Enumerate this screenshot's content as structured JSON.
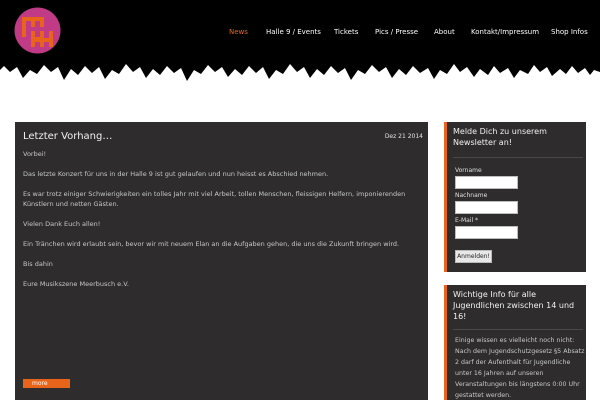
{
  "header": {
    "logo_icon": "mh-logo-icon",
    "nav": [
      {
        "label": "News",
        "active": true
      },
      {
        "label": "Halle 9 / Events",
        "active": false
      },
      {
        "label": "Tickets",
        "active": false
      },
      {
        "label": "Pics / Presse",
        "active": false
      },
      {
        "label": "About",
        "active": false
      },
      {
        "label": "Kontakt/Impressum",
        "active": false
      },
      {
        "label": "Shop Infos",
        "active": false
      }
    ]
  },
  "post": {
    "title": "Letzter Vorhang…",
    "date": "Dez 21 2014",
    "paragraphs": [
      "Vorbei!",
      "Das letzte Konzert für uns in der Halle 9 ist gut gelaufen und nun heisst es Abschied nehmen.",
      "Es war trotz einiger Schwierigkeiten ein tolles Jahr mit viel Arbeit, tollen Menschen, fleissigen Helfern, imponierenden Künstlern und netten Gästen.",
      "Vielen Dank Euch allen!",
      "Ein Tränchen wird erlaubt sein, bevor wir mit neuem Elan an die Aufgaben gehen, die uns die Zukunft bringen wird.",
      "Bis dahin",
      "Eure Musikszene Meerbusch e.V."
    ],
    "more_label": "more"
  },
  "newsletter": {
    "title": "Melde Dich zu unserem Newsletter an!",
    "first_name_label": "Vorname",
    "last_name_label": "Nachname",
    "email_label": "E-Mail *",
    "submit_label": "Anmelden!"
  },
  "info": {
    "title": "Wichtige Info für alle Jugendlichen zwischen 14 und 16!",
    "body": "Einige wissen es vielleicht noch nicht: Nach dem Jugendschutzgesetz §5 Absatz 2 darf der Aufenthalt für Jugendliche unter 16 Jahren auf unseren Veranstaltungen bis längstens 0:00 Uhr gestattet werden."
  },
  "colors": {
    "accent": "#e8641b",
    "logo_circle": "#c03a86",
    "header_bg": "#000000",
    "panel_bg": "#2e2c2c"
  }
}
